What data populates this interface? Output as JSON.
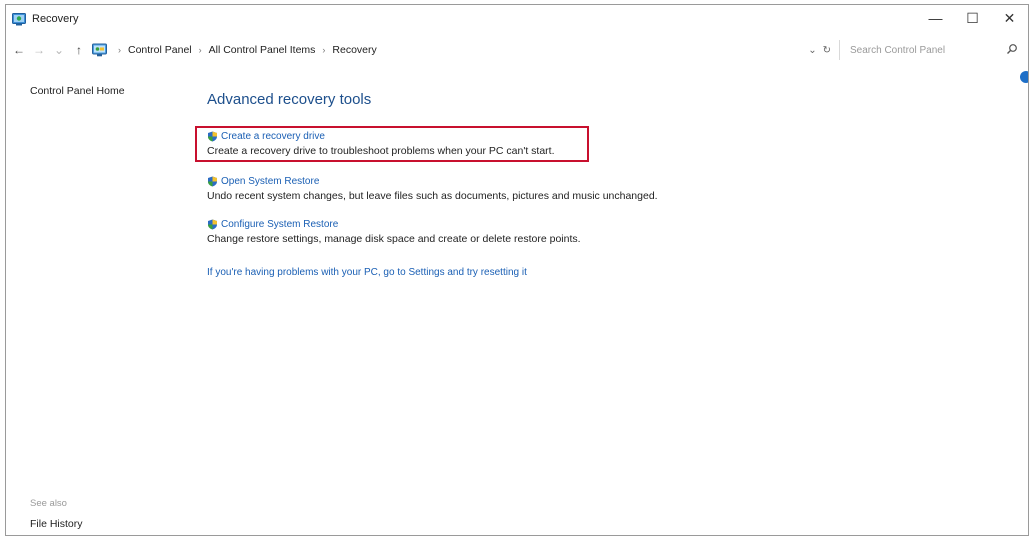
{
  "window": {
    "title": "Recovery",
    "minimize_glyph": "—",
    "maximize_glyph": "☐",
    "close_glyph": "✕"
  },
  "nav": {
    "back_glyph": "←",
    "forward_glyph": "→",
    "recent_glyph": "⌄",
    "up_glyph": "↑",
    "breadcrumbs": [
      "Control Panel",
      "All Control Panel Items",
      "Recovery"
    ],
    "separator": "›",
    "dropdown_glyph": "⌄",
    "refresh_glyph": "↻",
    "search_placeholder": "Search Control Panel"
  },
  "sidebar": {
    "home_link": "Control Panel Home",
    "see_also_label": "See also",
    "file_history_link": "File History"
  },
  "main": {
    "heading": "Advanced recovery tools",
    "tools": [
      {
        "link": "Create a recovery drive",
        "description": "Create a recovery drive to troubleshoot problems when your PC can't start.",
        "highlighted": true
      },
      {
        "link": "Open System Restore",
        "description": "Undo recent system changes, but leave files such as documents, pictures and music unchanged.",
        "highlighted": false
      },
      {
        "link": "Configure System Restore",
        "description": "Change restore settings, manage disk space and create or delete restore points.",
        "highlighted": false
      }
    ],
    "reset_link": "If you're having problems with your PC, go to Settings and try resetting it"
  },
  "colors": {
    "heading": "#1d4f8c",
    "link": "#1a5fb4",
    "highlight_border": "#c8102e",
    "shield_blue": "#2b6cc4",
    "shield_green": "#3aa13a",
    "shield_yellow": "#f2c12e"
  },
  "icons": {
    "title": "recovery-window-icon",
    "control_panel": "control-panel-icon",
    "tool": "uac-shield-icon",
    "search": "search-icon",
    "help": "help-icon"
  }
}
